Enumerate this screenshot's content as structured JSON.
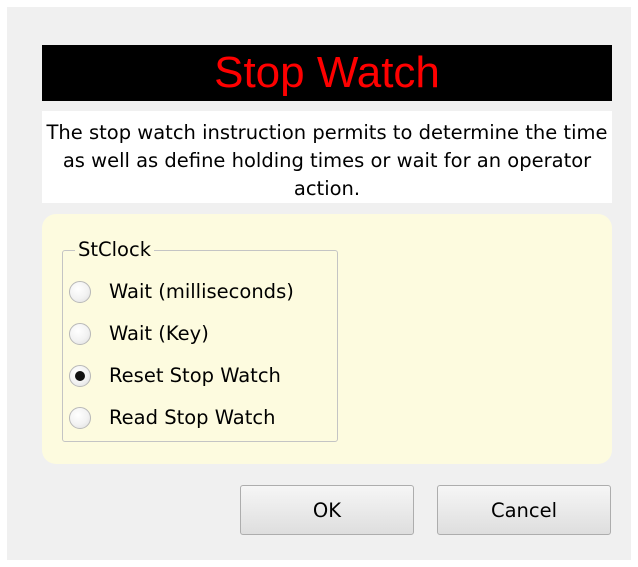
{
  "dialog": {
    "title": "Stop Watch",
    "description": "The stop watch instruction permits to determine the time as well as define holding times or wait for an operator action."
  },
  "group": {
    "legend": "StClock",
    "options": [
      {
        "label": "Wait (milliseconds)",
        "checked": false
      },
      {
        "label": "Wait (Key)",
        "checked": false
      },
      {
        "label": "Reset Stop Watch",
        "checked": true
      },
      {
        "label": "Read Stop Watch",
        "checked": false
      }
    ]
  },
  "buttons": {
    "ok_label": "OK",
    "cancel_label": "Cancel"
  },
  "colors": {
    "title_background": "#000000",
    "title_text": "#ff0000",
    "panel_background": "#fdfbdf",
    "dialog_background": "#f0f0f0"
  }
}
